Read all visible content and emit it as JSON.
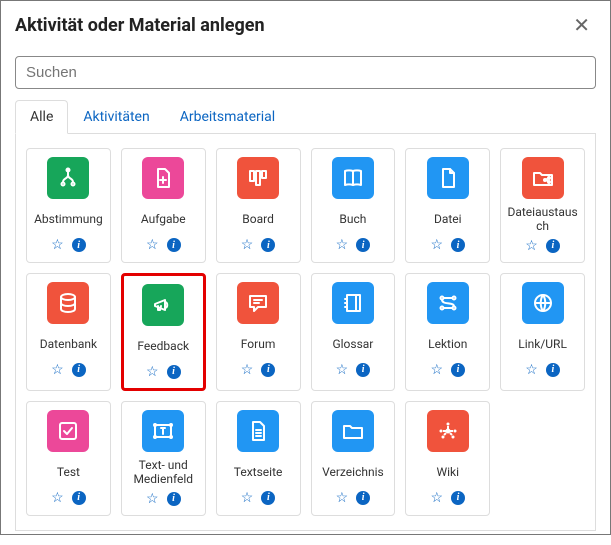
{
  "header": {
    "title": "Aktivität oder Material anlegen"
  },
  "search": {
    "placeholder": "Suchen"
  },
  "tabs": [
    {
      "label": "Alle",
      "active": true
    },
    {
      "label": "Aktivitäten",
      "active": false
    },
    {
      "label": "Arbeitsmaterial",
      "active": false
    }
  ],
  "items": [
    {
      "label": "Abstimmung",
      "icon": "branch",
      "color": "green",
      "highlight": false
    },
    {
      "label": "Aufgabe",
      "icon": "file-plus",
      "color": "pink",
      "highlight": false
    },
    {
      "label": "Board",
      "icon": "columns",
      "color": "orange",
      "highlight": false
    },
    {
      "label": "Buch",
      "icon": "book",
      "color": "blue",
      "highlight": false
    },
    {
      "label": "Datei",
      "icon": "file",
      "color": "blue",
      "highlight": false
    },
    {
      "label": "Dateiaustausch",
      "icon": "folder-share",
      "color": "orange",
      "highlight": false
    },
    {
      "label": "Datenbank",
      "icon": "database",
      "color": "orange",
      "highlight": false
    },
    {
      "label": "Feedback",
      "icon": "megaphone",
      "color": "green",
      "highlight": true
    },
    {
      "label": "Forum",
      "icon": "chat",
      "color": "orange",
      "highlight": false
    },
    {
      "label": "Glossar",
      "icon": "notebook",
      "color": "blue",
      "highlight": false
    },
    {
      "label": "Lektion",
      "icon": "path",
      "color": "blue",
      "highlight": false
    },
    {
      "label": "Link/URL",
      "icon": "globe",
      "color": "blue",
      "highlight": false
    },
    {
      "label": "Test",
      "icon": "check",
      "color": "pink",
      "highlight": false
    },
    {
      "label": "Text- und Medienfeld",
      "icon": "textbox",
      "color": "blue",
      "highlight": false
    },
    {
      "label": "Textseite",
      "icon": "file-text",
      "color": "blue",
      "highlight": false
    },
    {
      "label": "Verzeichnis",
      "icon": "folder",
      "color": "blue",
      "highlight": false
    },
    {
      "label": "Wiki",
      "icon": "network",
      "color": "orange",
      "highlight": false
    }
  ],
  "info_symbol": "i"
}
